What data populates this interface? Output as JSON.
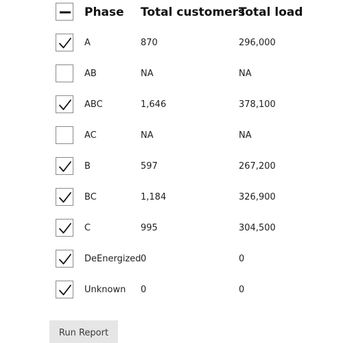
{
  "table": {
    "headers": {
      "phase": "Phase",
      "customers": "Total customers",
      "load": "Total load"
    },
    "select_all": "indeterminate",
    "rows": [
      {
        "phase": "A",
        "customers": "870",
        "load": "296,000",
        "checked": true
      },
      {
        "phase": "AB",
        "customers": "NA",
        "load": "NA",
        "checked": false
      },
      {
        "phase": "ABC",
        "customers": "1,646",
        "load": "378,100",
        "checked": true
      },
      {
        "phase": "AC",
        "customers": "NA",
        "load": "NA",
        "checked": false
      },
      {
        "phase": "B",
        "customers": "597",
        "load": "267,200",
        "checked": true
      },
      {
        "phase": "BC",
        "customers": "1,184",
        "load": "326,900",
        "checked": true
      },
      {
        "phase": "C",
        "customers": "995",
        "load": "304,500",
        "checked": true
      },
      {
        "phase": "DeEnergized",
        "customers": "0",
        "load": "0",
        "checked": true
      },
      {
        "phase": "Unknown",
        "customers": "0",
        "load": "0",
        "checked": true
      }
    ]
  },
  "run_button": {
    "label": "Run Report"
  }
}
